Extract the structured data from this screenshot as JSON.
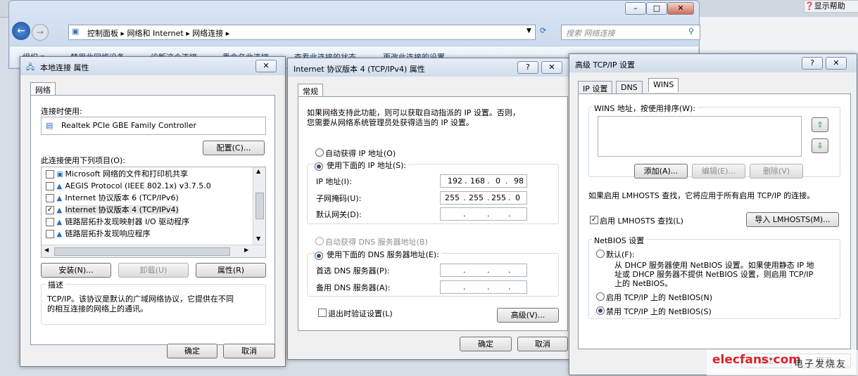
{
  "help": {
    "label": "显示帮助"
  },
  "explorer": {
    "breadcrumb": [
      "控制面板",
      "网络和 Internet",
      "网络连接"
    ],
    "search_placeholder": "搜索 网络连接",
    "commands": [
      "组织 ▾",
      "禁用此网络设备",
      "诊断这个连接",
      "重命名此连接",
      "查看此连接的状态",
      "更改此连接的设置"
    ]
  },
  "dlg1": {
    "title": "本地连接 属性",
    "tab": "网络",
    "connect_using_label": "连接时使用:",
    "adapter": "Realtek PCIe GBE Family Controller",
    "configure": "配置(C)...",
    "items_label": "此连接使用下列项目(O):",
    "items": [
      {
        "label": "Microsoft 网络的文件和打印机共享",
        "checked": false
      },
      {
        "label": "AEGIS Protocol (IEEE 802.1x) v3.7.5.0",
        "checked": false
      },
      {
        "label": "Internet 协议版本 6 (TCP/IPv6)",
        "checked": false
      },
      {
        "label": "Internet 协议版本 4 (TCP/IPv4)",
        "checked": true
      },
      {
        "label": "链路层拓扑发现映射器 I/O 驱动程序",
        "checked": false
      },
      {
        "label": "链路层拓扑发现响应程序",
        "checked": false
      }
    ],
    "install": "安装(N)...",
    "uninstall": "卸载(U)",
    "properties": "属性(R)",
    "desc_title": "描述",
    "desc_text": [
      "TCP/IP。该协议是默认的广域网络协议，它提供在不同",
      "的相互连接的网络上的通讯。"
    ],
    "ok": "确定",
    "cancel": "取消"
  },
  "dlg2": {
    "title": "Internet 协议版本 4 (TCP/IPv4) 属性",
    "tab": "常规",
    "intro": [
      "如果网络支持此功能，则可以获取自动指派的 IP 设置。否则，",
      "您需要从网络系统管理员处获得适当的 IP 设置。"
    ],
    "auto_ip": "自动获得 IP 地址(O)",
    "manual_ip": "使用下面的 IP 地址(S):",
    "ip_label": "IP 地址(I):",
    "ip": [
      "192",
      "168",
      "0",
      "98"
    ],
    "mask_label": "子网掩码(U):",
    "mask": [
      "255",
      "255",
      "255",
      "0"
    ],
    "gateway_label": "默认网关(D):",
    "auto_dns": "自动获得 DNS 服务器地址(B)",
    "manual_dns": "使用下面的 DNS 服务器地址(E):",
    "dns1_label": "首选 DNS 服务器(P):",
    "dns2_label": "备用 DNS 服务器(A):",
    "validate": "退出时验证设置(L)",
    "advanced": "高级(V)...",
    "ok": "确定",
    "cancel": "取消"
  },
  "dlg3": {
    "title": "高级 TCP/IP 设置",
    "tabs": [
      "IP 设置",
      "DNS",
      "WINS"
    ],
    "wins_label": "WINS 地址，按使用排序(W):",
    "add": "添加(A)...",
    "edit": "编辑(E)...",
    "remove": "删除(V)",
    "lmhosts_info": "如果启用 LMHOSTS 查找，它将应用于所有启用 TCP/IP 的连接。",
    "enable_lmhosts": "启用 LMHOSTS 查找(L)",
    "import_lmhosts": "导入 LMHOSTS(M)...",
    "netbios_title": "NetBIOS 设置",
    "default": "默认(F):",
    "default_desc": [
      "从 DHCP 服务器使用 NetBIOS 设置。如果使用静态 IP 地",
      "址或 DHCP 服务器不提供 NetBIOS 设置，则启用 TCP/IP",
      "上的 NetBIOS。"
    ],
    "enable_netbios": "启用 TCP/IP 上的 NetBIOS(N)",
    "disable_netbios": "禁用 TCP/IP 上的 NetBIOS(S)",
    "ok": "确定",
    "cancel": "取消"
  },
  "watermark": {
    "brand": "elecfans·com",
    "cn": "电子发烧友"
  }
}
